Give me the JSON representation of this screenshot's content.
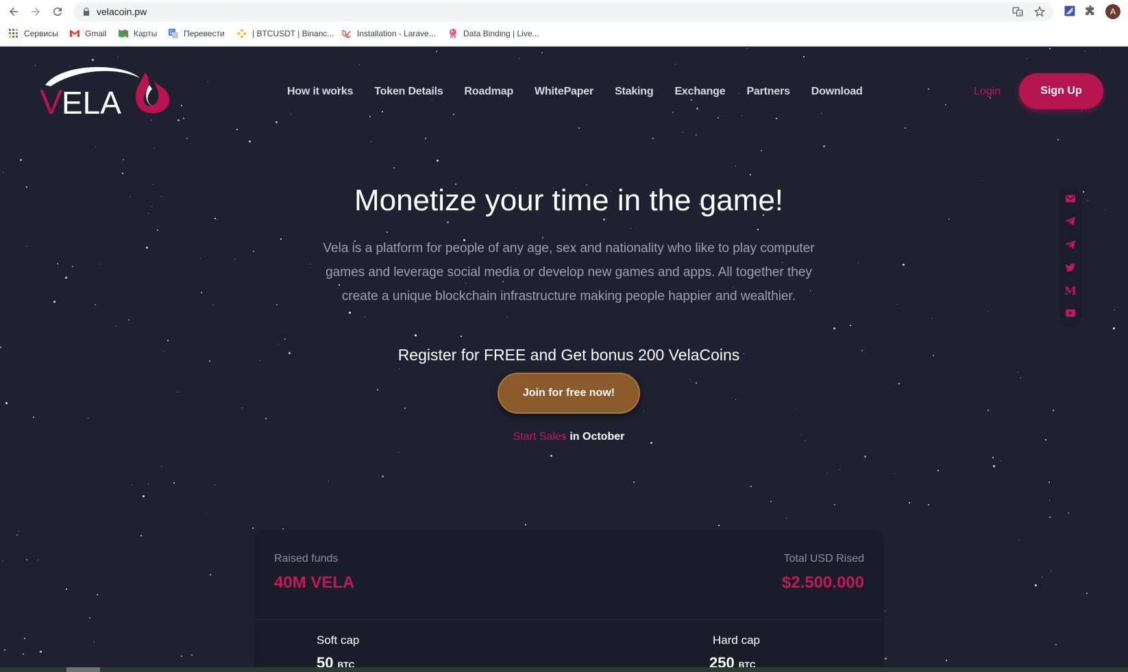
{
  "browser": {
    "url": "velacoin.pw",
    "avatar_letter": "A",
    "bookmarks": [
      {
        "label": "Сервисы",
        "icon": "apps-grid-icon"
      },
      {
        "label": "Gmail",
        "icon": "gmail-icon"
      },
      {
        "label": "Карты",
        "icon": "maps-icon"
      },
      {
        "label": "Перевести",
        "icon": "translate-icon"
      },
      {
        "label": "| BTCUSDT | Binanc...",
        "icon": "binance-icon"
      },
      {
        "label": "Installation - Larave...",
        "icon": "laravel-icon"
      },
      {
        "label": "Data Binding | Live...",
        "icon": "livewire-icon"
      }
    ]
  },
  "site": {
    "logo_text": "ELA",
    "logo_initial": "V",
    "nav": [
      "How it works",
      "Token Details",
      "Roadmap",
      "WhitePaper",
      "Staking",
      "Exchange",
      "Partners",
      "Download"
    ],
    "login": "Login",
    "signup": "Sign Up",
    "accent_color": "#c2185b"
  },
  "hero": {
    "title": "Monetize your time in the game!",
    "description": "Vela is a platform for people of any age, sex and nationality who like to play computer games and leverage social media or develop new games and apps. All together they create a unique blockchain infrastructure making people happier and wealthier.",
    "register": "Register for FREE and Get bonus 200 VelaCoins",
    "join_button": "Join for free now!",
    "start_highlight": "Start Sales",
    "start_rest": "in October"
  },
  "social_icons": [
    "mail-icon",
    "telegram-icon",
    "telegram-icon",
    "twitter-icon",
    "medium-icon",
    "youtube-icon"
  ],
  "stats": {
    "raised_label": "Raised funds",
    "raised_value": "40M VELA",
    "total_label": "Total USD Rised",
    "total_value": "$2.500.000",
    "soft_label": "Soft cap",
    "soft_value": "50",
    "soft_unit": "BTC",
    "hard_label": "Hard cap",
    "hard_value": "250",
    "hard_unit": "BTC"
  }
}
